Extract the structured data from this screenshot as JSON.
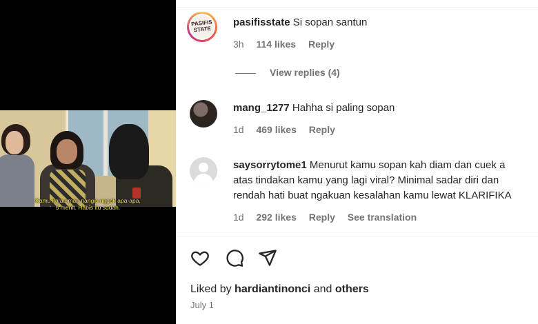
{
  "video": {
    "subtitle_line1": "Kamu kalau mau nangis nggak apa-apa,",
    "subtitle_line2": "5 menit. Habis itu sudah."
  },
  "comments": [
    {
      "username": "pasifisstate",
      "text": "Si sopan santun",
      "time": "3h",
      "likes": "114 likes",
      "reply_label": "Reply",
      "avatar_text_line1": "PASIFIS",
      "avatar_text_line2": "STATE"
    },
    {
      "username": "mang_1277",
      "text": "Hahha si paling sopan",
      "time": "1d",
      "likes": "469 likes",
      "reply_label": "Reply"
    },
    {
      "username": "saysorrytome1",
      "text_line1": "Menurut kamu sopan kah diam dan cuek a",
      "text_line2": "atas tindakan kamu yang lagi viral? Minimal sadar diri dan",
      "text_line3": "rendah hati buat ngakuan kesalahan kamu lewat KLARIFIKA",
      "time": "1d",
      "likes": "292 likes",
      "reply_label": "Reply",
      "translate_label": "See translation"
    }
  ],
  "view_replies": "View replies (4)",
  "actions": {
    "like_icon": "heart-icon",
    "comment_icon": "comment-icon",
    "share_icon": "share-icon"
  },
  "footer": {
    "liked_prefix": "Liked by",
    "liked_user": "hardiantinonci",
    "liked_and": "and",
    "liked_others": "others",
    "date": "July 1"
  }
}
